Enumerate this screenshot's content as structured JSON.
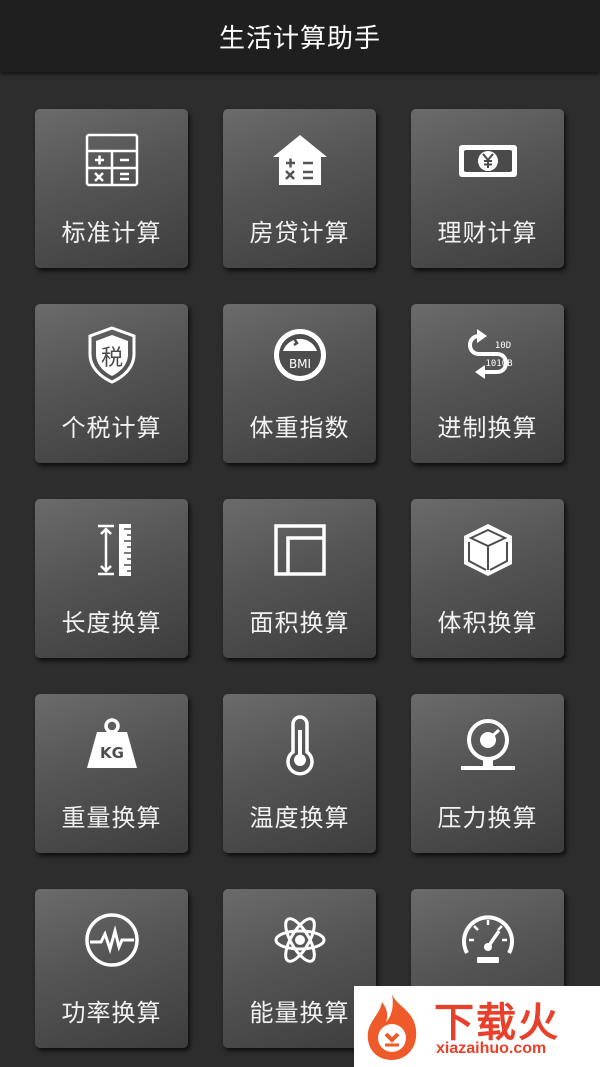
{
  "header": {
    "title": "生活计算助手"
  },
  "tiles": [
    {
      "label": "标准计算",
      "icon": "calculator-icon"
    },
    {
      "label": "房贷计算",
      "icon": "house-calc-icon"
    },
    {
      "label": "理财计算",
      "icon": "yen-banknote-icon"
    },
    {
      "label": "个税计算",
      "icon": "tax-shield-icon"
    },
    {
      "label": "体重指数",
      "icon": "bmi-gauge-icon",
      "icon_text": "BMI"
    },
    {
      "label": "进制换算",
      "icon": "base-convert-icon",
      "icon_text_top": "10D",
      "icon_text_bottom": "1010B"
    },
    {
      "label": "长度换算",
      "icon": "ruler-icon"
    },
    {
      "label": "面积换算",
      "icon": "area-square-icon"
    },
    {
      "label": "体积换算",
      "icon": "cube-icon"
    },
    {
      "label": "重量换算",
      "icon": "kg-weight-icon",
      "icon_text": "KG"
    },
    {
      "label": "温度换算",
      "icon": "thermometer-icon"
    },
    {
      "label": "压力换算",
      "icon": "pressure-gauge-icon"
    },
    {
      "label": "功率换算",
      "icon": "power-pulse-icon"
    },
    {
      "label": "能量换算",
      "icon": "atom-icon"
    },
    {
      "label": "",
      "icon": "speedometer-icon"
    }
  ],
  "watermark": {
    "name": "下载火",
    "url": "xiazaihuo.com"
  },
  "colors": {
    "header_bg": "#1f1f1f",
    "page_bg": "#2d2d2d",
    "tile_top": "#6b6b6b",
    "tile_bottom": "#3d3d3d",
    "icon": "#ffffff",
    "watermark": "#e8402a"
  }
}
